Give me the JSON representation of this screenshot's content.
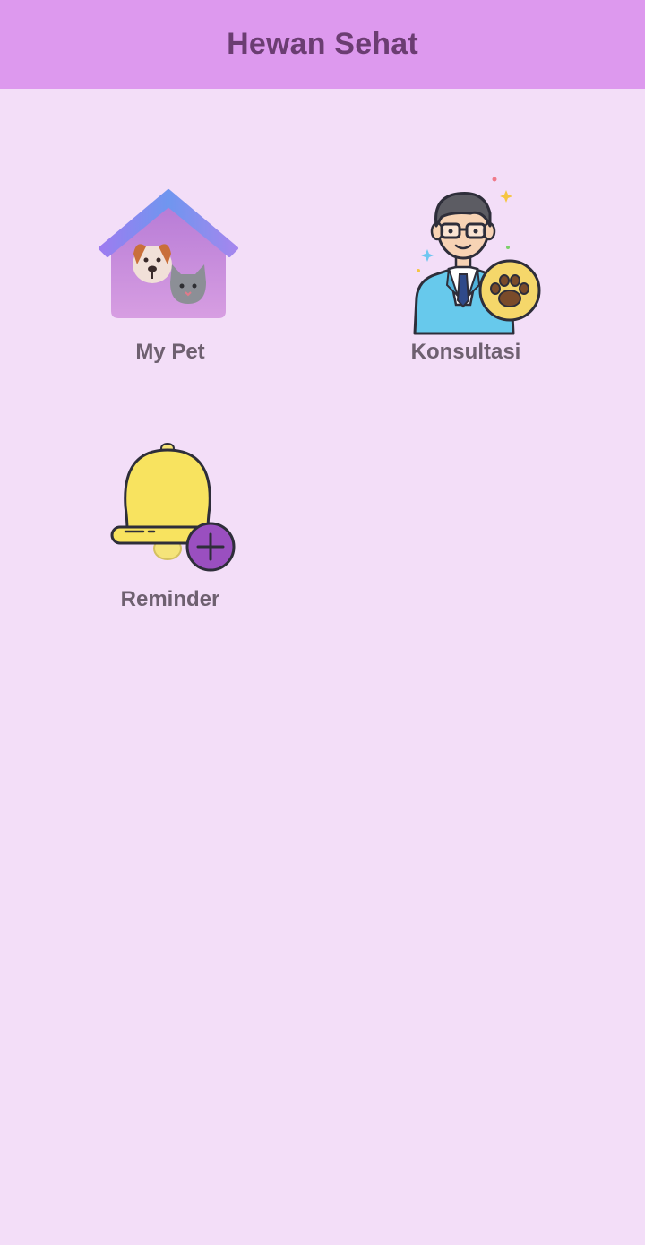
{
  "app_bar": {
    "title": "Hewan Sehat",
    "background": "#dd99ee",
    "title_color": "#6b3d72"
  },
  "page": {
    "background": "#f3def8"
  },
  "menu": [
    {
      "label": "My Pet",
      "icon": "pet-house-icon"
    },
    {
      "label": "Konsultasi",
      "icon": "vet-doctor-icon"
    },
    {
      "label": "Reminder",
      "icon": "bell-add-icon"
    }
  ]
}
